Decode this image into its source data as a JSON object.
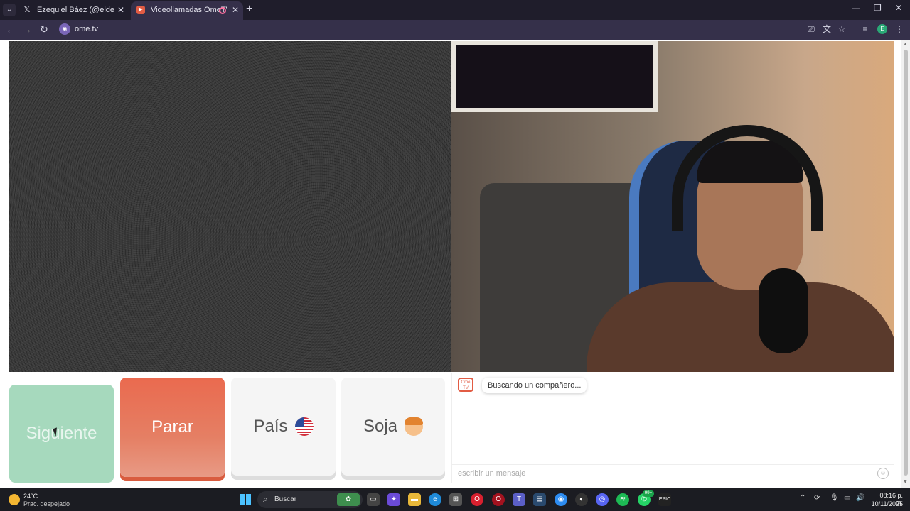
{
  "browser": {
    "tabs": [
      {
        "title": "Ezequiel Báez (@eldelsinzzz) / X",
        "favicon": "x-logo-icon",
        "active": false
      },
      {
        "title": "Videollamadas OmeTV — A",
        "favicon": "ometv-icon",
        "active": true
      }
    ],
    "url": "ome.tv",
    "profile_initial": "E"
  },
  "buttons": {
    "next": "Siguiente",
    "stop": "Parar",
    "country": "País",
    "gender": "Soja"
  },
  "chat": {
    "logo_text": "Ome TV",
    "status_message": "Buscando un compañero...",
    "input_placeholder": "escribir un mensaje"
  },
  "taskbar": {
    "weather_temp": "24°C",
    "weather_desc": "Prac. despejado",
    "search_label": "Buscar",
    "badge_count": "99+",
    "time": "08:16 p. m.",
    "date": "10/11/2025"
  },
  "colors": {
    "next_button": "#a6d9bd",
    "stop_button": "#e8674c",
    "neutral_button": "#f5f5f5",
    "browser_chrome": "#35304a"
  }
}
